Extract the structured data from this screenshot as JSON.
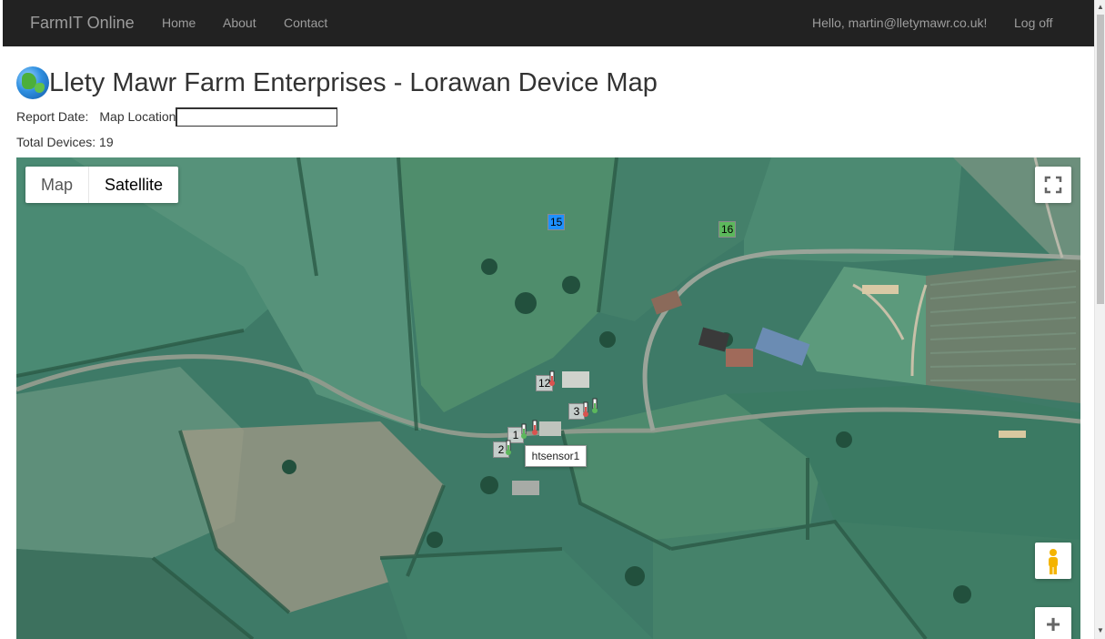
{
  "navbar": {
    "brand": "FarmIT Online",
    "links": [
      "Home",
      "About",
      "Contact"
    ],
    "greeting": "Hello, martin@lletymawr.co.uk!",
    "logoff": "Log off"
  },
  "page": {
    "title": "Llety Mawr Farm Enterprises - Lorawan Device Map",
    "report_date_label": "Report Date:",
    "map_location_label": "Map Location",
    "map_location_value": "",
    "total_devices_label": "Total Devices: 19"
  },
  "map": {
    "type_controls": {
      "map": "Map",
      "satellite": "Satellite",
      "selected": "Satellite"
    },
    "zoom_in_symbol": "+",
    "markers": [
      {
        "label": "15",
        "color": "#1e90ff"
      },
      {
        "label": "16",
        "color": "#5cb85c"
      },
      {
        "label": "12",
        "color": "#dddddd"
      },
      {
        "label": "3",
        "color": "#dddddd"
      },
      {
        "label": "1",
        "color": "#dddddd"
      },
      {
        "label": "2",
        "color": "#dddddd"
      }
    ],
    "tooltip": "htsensor1",
    "icons": {
      "fullscreen": "fullscreen-icon",
      "pegman": "pegman-icon",
      "zoom": "plus-icon",
      "globe": "globe-icon"
    }
  },
  "colors": {
    "navbar_bg": "#222222",
    "nav_text": "#9d9d9d",
    "title_text": "#333333"
  }
}
